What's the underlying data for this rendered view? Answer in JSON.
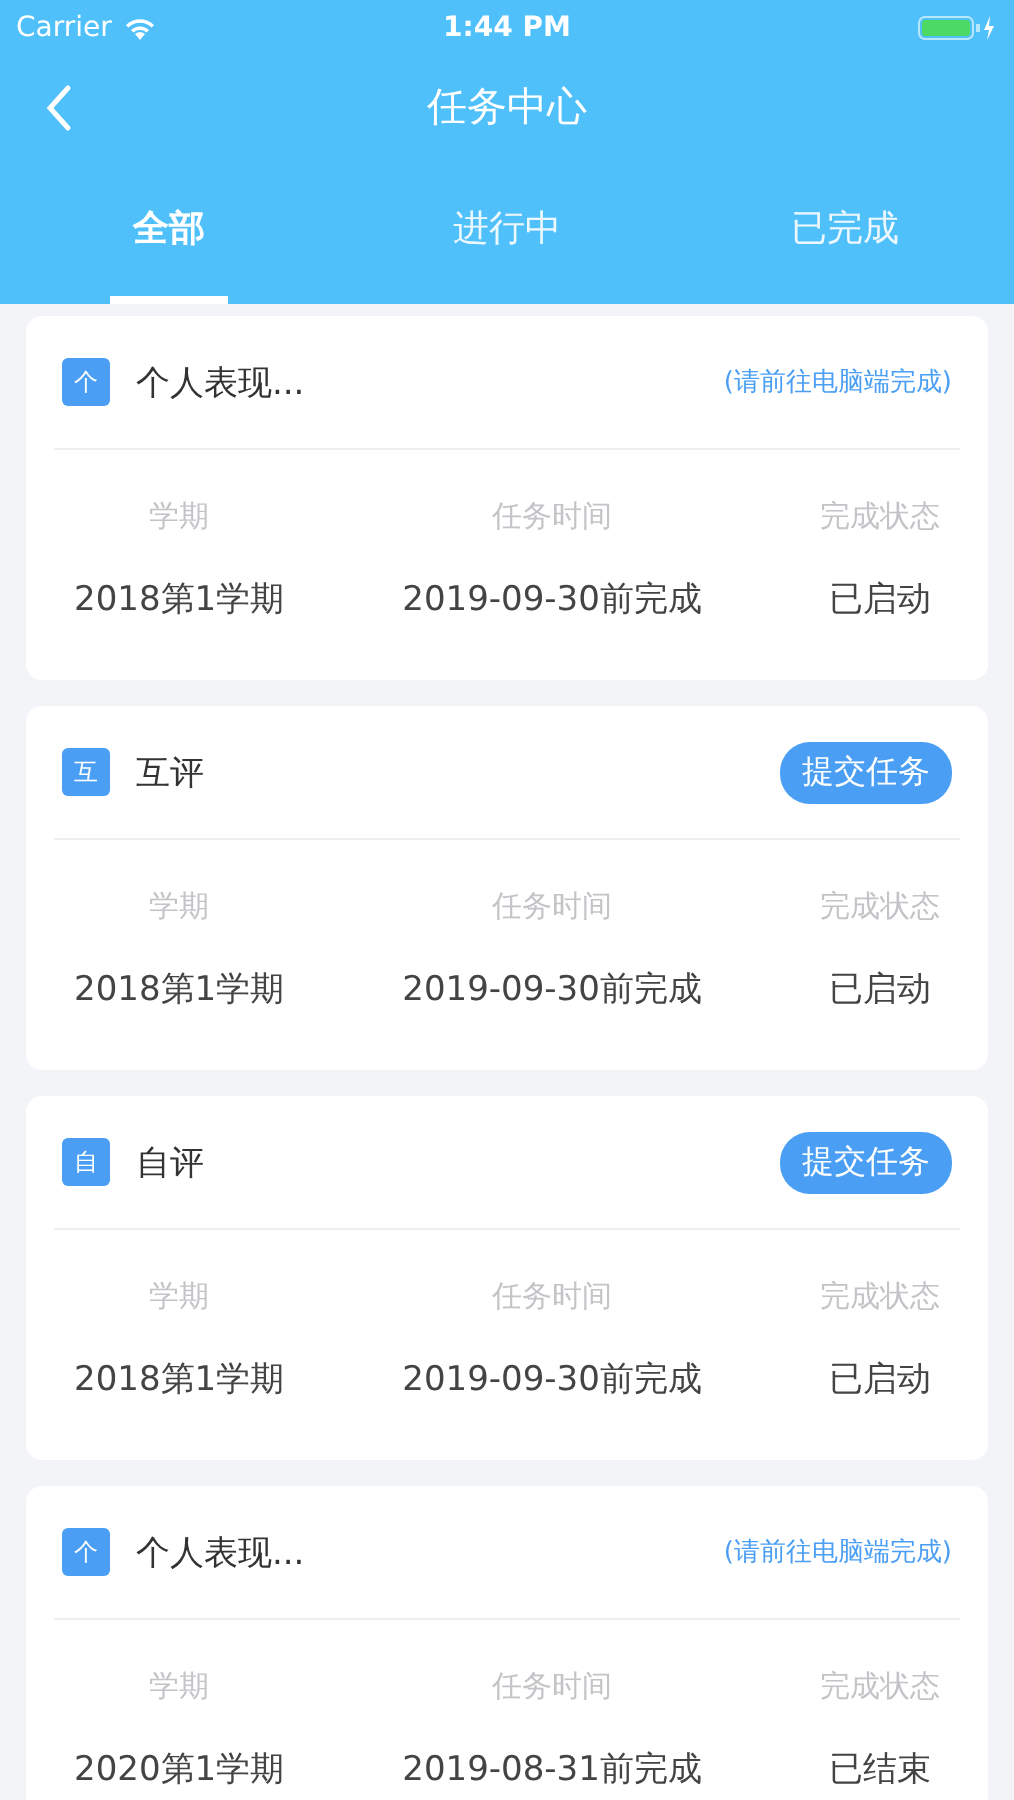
{
  "status_bar": {
    "carrier": "Carrier",
    "time": "1:44 PM"
  },
  "nav": {
    "title": "任务中心"
  },
  "tabs": [
    {
      "label": "全部",
      "selected": true
    },
    {
      "label": "进行中",
      "selected": false
    },
    {
      "label": "已完成",
      "selected": false
    }
  ],
  "tasks": [
    {
      "badge": "个",
      "title": "个人表现...",
      "action": {
        "kind": "note",
        "label": "(请前往电脑端完成)"
      },
      "fields": [
        {
          "label": "学期",
          "value": "2018第1学期"
        },
        {
          "label": "任务时间",
          "value": "2019-09-30前完成"
        },
        {
          "label": "完成状态",
          "value": "已启动"
        }
      ]
    },
    {
      "badge": "互",
      "title": "互评",
      "action": {
        "kind": "button",
        "label": "提交任务"
      },
      "fields": [
        {
          "label": "学期",
          "value": "2018第1学期"
        },
        {
          "label": "任务时间",
          "value": "2019-09-30前完成"
        },
        {
          "label": "完成状态",
          "value": "已启动"
        }
      ]
    },
    {
      "badge": "自",
      "title": "自评",
      "action": {
        "kind": "button",
        "label": "提交任务"
      },
      "fields": [
        {
          "label": "学期",
          "value": "2018第1学期"
        },
        {
          "label": "任务时间",
          "value": "2019-09-30前完成"
        },
        {
          "label": "完成状态",
          "value": "已启动"
        }
      ]
    },
    {
      "badge": "个",
      "title": "个人表现...",
      "action": {
        "kind": "note",
        "label": "(请前往电脑端完成)"
      },
      "fields": [
        {
          "label": "学期",
          "value": "2020第1学期"
        },
        {
          "label": "任务时间",
          "value": "2019-08-31前完成"
        },
        {
          "label": "完成状态",
          "value": "已结束"
        }
      ]
    }
  ]
}
